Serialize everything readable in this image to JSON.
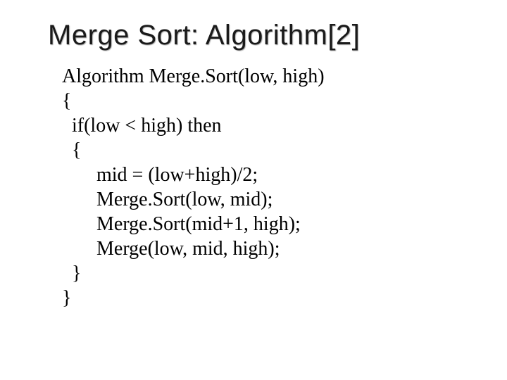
{
  "slide": {
    "title": "Merge Sort:  Algorithm[2]",
    "line1": "Algorithm Merge.Sort(low, high)",
    "line2": "{",
    "line3": "  if(low < high) then",
    "line4": "  {",
    "line5": "       mid = (low+high)/2;",
    "line6": "       Merge.Sort(low, mid);",
    "line7": "       Merge.Sort(mid+1, high);",
    "line8": "       Merge(low, mid, high);",
    "line9": "  }",
    "line10": "}"
  }
}
